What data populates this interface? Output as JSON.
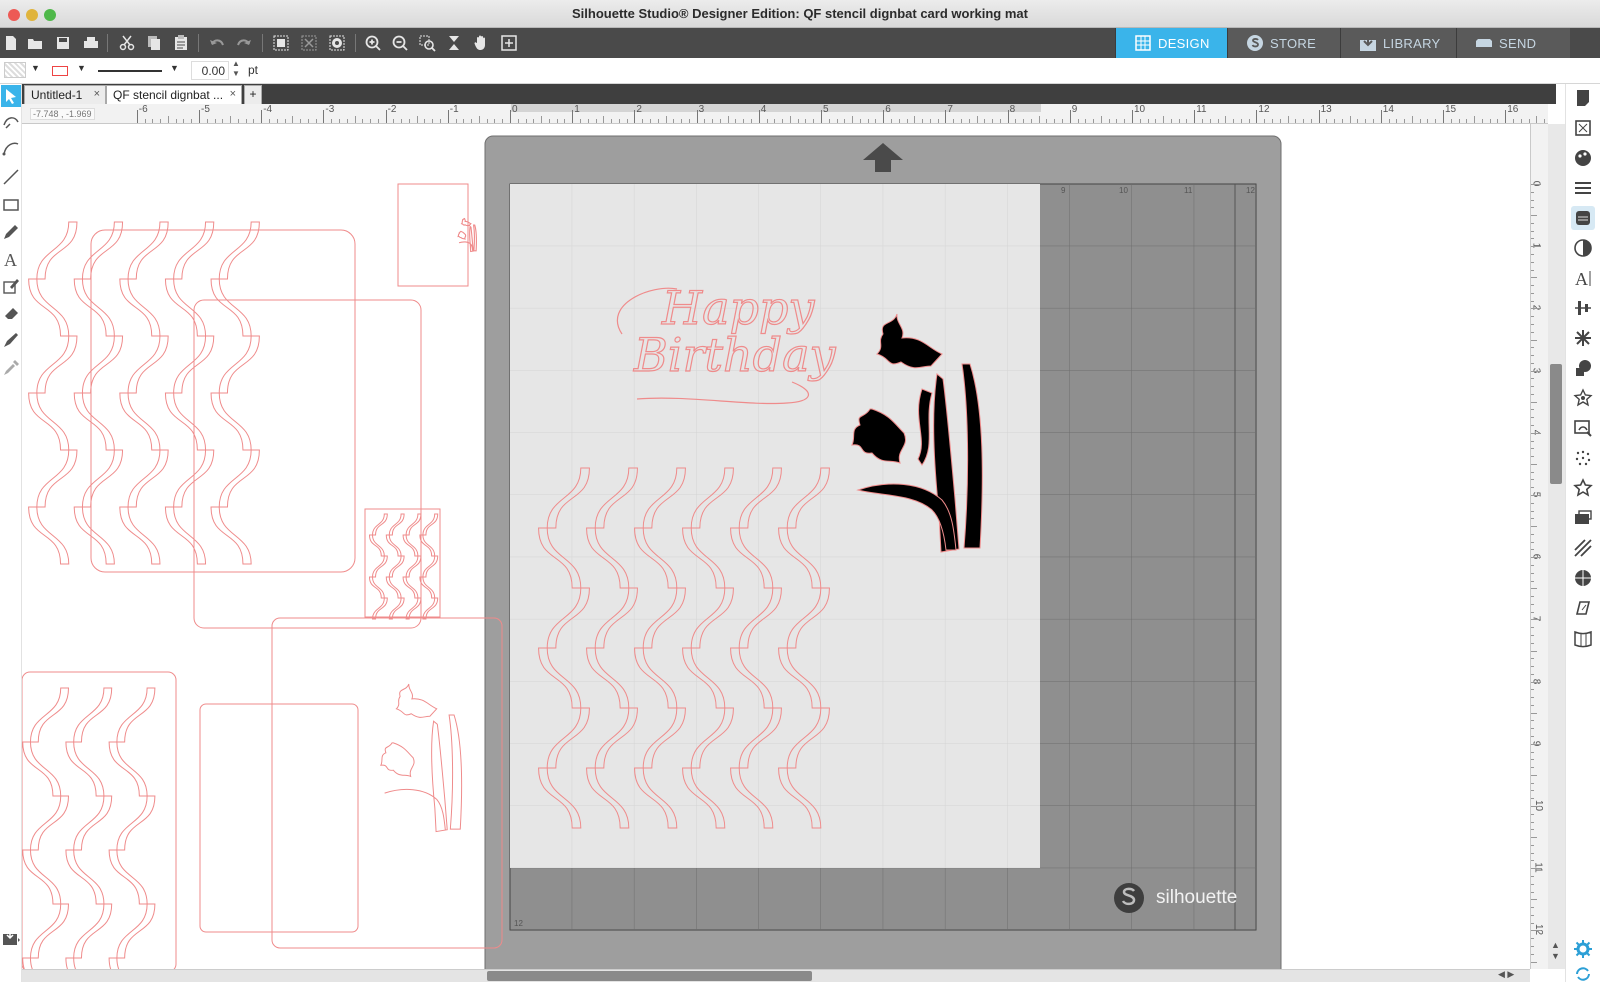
{
  "window": {
    "title": "Silhouette Studio® Designer Edition: QF stencil dignbat card working mat"
  },
  "nav_tabs": [
    {
      "label": "DESIGN",
      "icon": "grid-icon",
      "active": true
    },
    {
      "label": "STORE",
      "icon": "s-logo-icon",
      "active": false
    },
    {
      "label": "LIBRARY",
      "icon": "download-icon",
      "active": false
    },
    {
      "label": "SEND",
      "icon": "cutter-icon",
      "active": false
    }
  ],
  "properties": {
    "line_weight_value": "0.00",
    "line_weight_unit": "pt"
  },
  "document_tabs": [
    {
      "label": "Untitled-1",
      "close": "×"
    },
    {
      "label": "QF stencil dignbat ...",
      "close": "×"
    }
  ],
  "add_tab_label": "+",
  "ruler": {
    "cursor_coordinates": "-7.748 , -1.969",
    "horizontal_labels": [
      "-6",
      "-5",
      "-4",
      "-3",
      "-2",
      "-1",
      "0",
      "1",
      "2",
      "3",
      "4",
      "5",
      "6",
      "7",
      "8",
      "9",
      "10",
      "11",
      "12",
      "13",
      "14",
      "15",
      "16"
    ],
    "vertical_labels": [
      "0",
      "1",
      "2",
      "3",
      "4",
      "5",
      "6",
      "7",
      "8",
      "9",
      "10",
      "11",
      "12"
    ]
  },
  "cutting_mat": {
    "brand_label": "silhouette",
    "corner_label": "12",
    "grid_top_labels": [
      "9",
      "10",
      "11",
      "12"
    ]
  },
  "design": {
    "greeting_line1": "Happy",
    "greeting_line2": "Birthday"
  },
  "colors": {
    "toolbar_bg": "#4a4a4a",
    "accent": "#3ab4ea",
    "cut_line": "#f08a8a",
    "mat_gray": "#9a9a9a",
    "paper": "#e8e8e8"
  }
}
